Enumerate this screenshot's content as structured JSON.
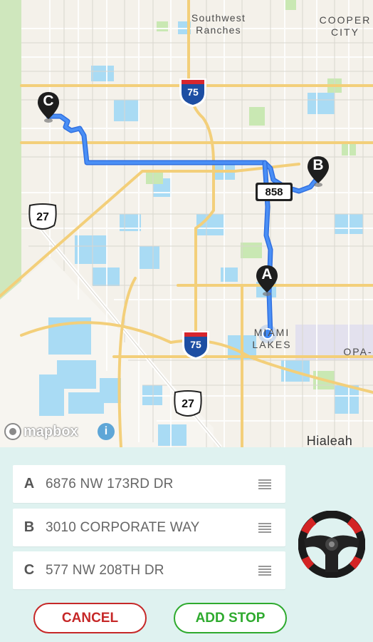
{
  "map": {
    "labels": {
      "southwest_ranches": "Southwest\nRanches",
      "cooper_city": "COOPER\nCITY",
      "miami_lakes": "MIAMI\nLAKES",
      "hialeah": "Hialeah",
      "opa": "OPA-"
    },
    "shields": {
      "i75_top": "75",
      "i75_bottom": "75",
      "us27_left": "27",
      "us27_bottom": "27",
      "fl858": "858"
    },
    "markers": {
      "a": "A",
      "b": "B",
      "c": "C"
    },
    "attribution": {
      "logo_text": "mapbox",
      "info_icon": "i"
    },
    "colors": {
      "route": "#3b7ff0",
      "water": "#a9dbf4",
      "park": "#c9e8b3",
      "highway": "#f3cf7a",
      "user_location": "#3d86f2"
    }
  },
  "stops": [
    {
      "letter": "A",
      "address": "6876 NW 173RD DR"
    },
    {
      "letter": "B",
      "address": "3010 CORPORATE WAY"
    },
    {
      "letter": "C",
      "address": "577 NW 208TH DR"
    }
  ],
  "buttons": {
    "cancel": "CANCEL",
    "add_stop": "ADD STOP"
  },
  "icons": {
    "steering_wheel": "steering-wheel-icon",
    "drag_handle": "drag-handle-icon"
  }
}
